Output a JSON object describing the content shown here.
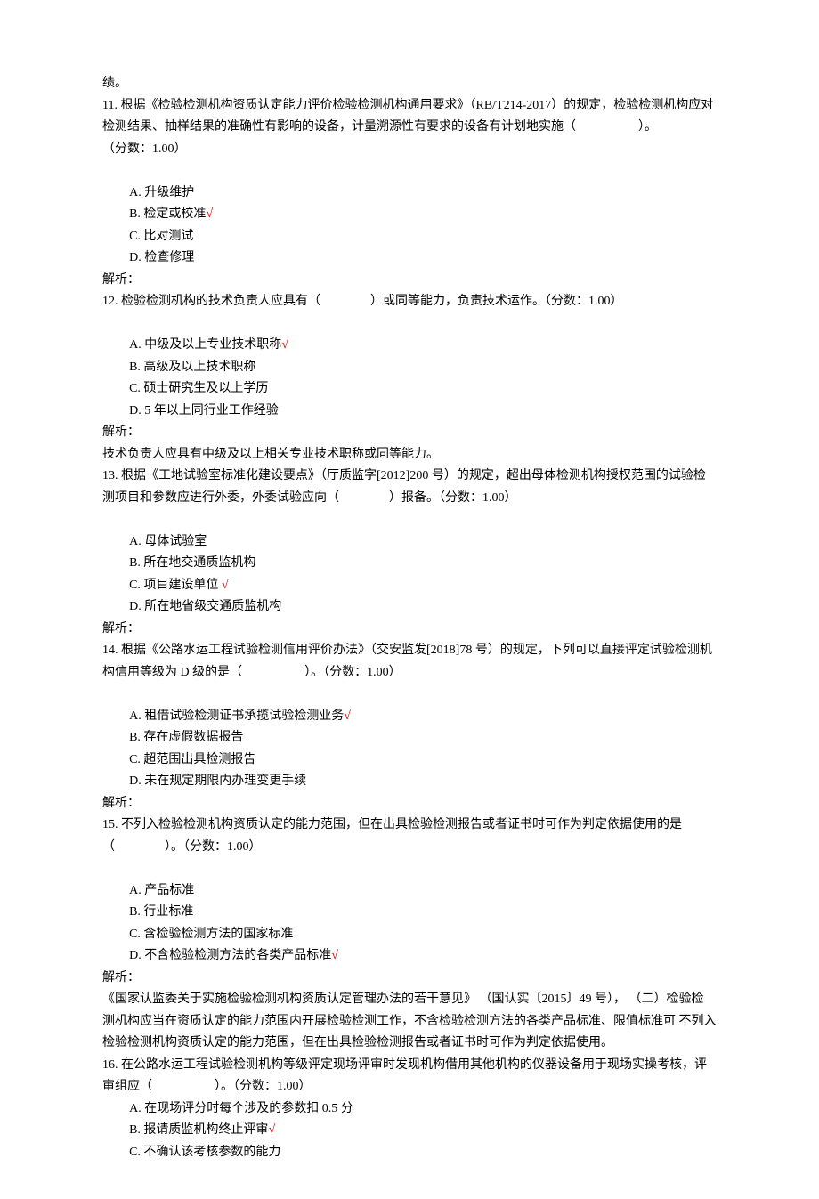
{
  "lead": "绩。",
  "q11": {
    "stem1": "11. 根据《检验检测机构资质认定能力评价检验检测机构通用要求》（RB/T214-2017）的规定，检验检测机构应对检测结果、抽样结果的准确性有影响的设备，计量溯源性有要求的设备有计划地实施（　　　　　）。",
    "score": "（分数：1.00）",
    "A": "A. 升级维护",
    "B": "B. 检定或校准",
    "C": "C. 比对测试",
    "D": "D. 检查修理",
    "ans": "解析："
  },
  "q12": {
    "stem": "12. 检验检测机构的技术负责人应具有（　　　　）或同等能力，负责技术运作。（分数：1.00）",
    "A": "A. 中级及以上专业技术职称",
    "B": "B. 高级及以上技术职称",
    "C": "C. 硕士研究生及以上学历",
    "D": "D. 5 年以上同行业工作经验",
    "ans": "解析：",
    "exp": "技术负责人应具有中级及以上相关专业技术职称或同等能力。"
  },
  "q13": {
    "stem1": "13. 根据《工地试验室标准化建设要点》（厅质监字[2012]200 号）的规定，超出母体检测机构授权范围的试验检测项目和参数应进行外委，外委试验应向（　　　　）报备。（分数：1.00）",
    "A": "A. 母体试验室",
    "B": "B. 所在地交通质监机构",
    "C": "C. 项目建设单位 ",
    "D": "D. 所在地省级交通质监机构",
    "ans": "解析："
  },
  "q14": {
    "stem1": "14. 根据《公路水运工程试验检测信用评价办法》（交安监发[2018]78 号）的规定，下列可以直接评定试验检测机构信用等级为 D 级的是（　　　　　）。（分数：1.00）",
    "A": "A. 租借试验检测证书承揽试验检测业务",
    "B": "B. 存在虚假数据报告",
    "C": "C. 超范围出具检测报告",
    "D": "D. 未在规定期限内办理变更手续",
    "ans": "解析："
  },
  "q15": {
    "stem1": "15. 不列入检验检测机构资质认定的能力范围，但在出具检验检测报告或者证书时可作为判定依据使用的是",
    "stem2": "（　　　　）。（分数：1.00）",
    "A": "A. 产品标准",
    "B": "B. 行业标准",
    "C": "C. 含检验检测方法的国家标准",
    "D": "D. 不含检验检测方法的各类产品标准",
    "ans": "解析：",
    "exp": "《国家认监委关于实施检验检测机构资质认定管理办法的若干意见》 （国认实〔2015〕49 号）， （二）检验检 测机构应当在资质认定的能力范围内开展检验检测工作，不含检验检测方法的各类产品标准、限值标准可 不列入检验检测机构资质认定的能力范围，但在出具检验检测报告或者证书时可作为判定依据使用。"
  },
  "q16": {
    "stem1": "16. 在公路水运工程试验检测机构等级评定现场评审时发现机构借用其他机构的仪器设备用于现场实操考核，评审组应（　　　　　）。（分数：1.00）",
    "A": "A. 在现场评分时每个涉及的参数扣 0.5 分",
    "B": "B. 报请质监机构终止评审",
    "C": "C. 不确认该考核参数的能力"
  },
  "mark": "√"
}
